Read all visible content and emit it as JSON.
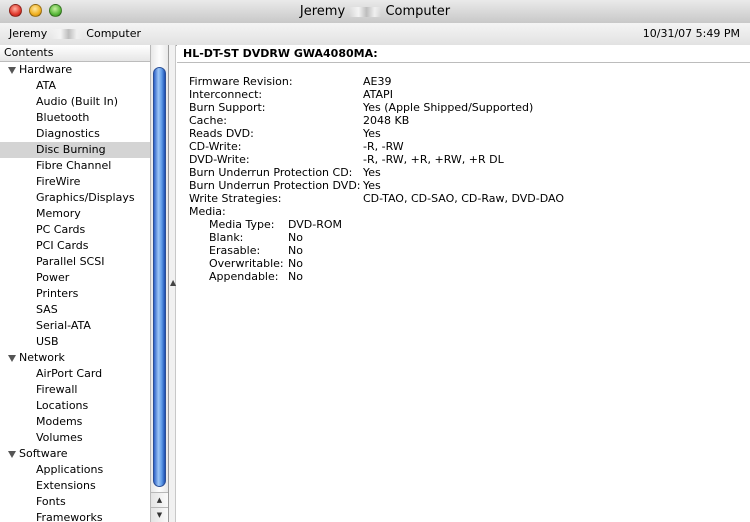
{
  "window": {
    "title_left": "Jeremy",
    "title_right": "Computer",
    "header_left_a": "Jeremy",
    "header_left_b": "Computer",
    "datetime": "10/31/07 5:49 PM"
  },
  "sidebar": {
    "header": "Contents",
    "rows": [
      {
        "label": "Hardware",
        "type": "category"
      },
      {
        "label": "ATA",
        "type": "item"
      },
      {
        "label": "Audio (Built In)",
        "type": "item"
      },
      {
        "label": "Bluetooth",
        "type": "item"
      },
      {
        "label": "Diagnostics",
        "type": "item"
      },
      {
        "label": "Disc Burning",
        "type": "item",
        "selected": true
      },
      {
        "label": "Fibre Channel",
        "type": "item"
      },
      {
        "label": "FireWire",
        "type": "item"
      },
      {
        "label": "Graphics/Displays",
        "type": "item"
      },
      {
        "label": "Memory",
        "type": "item"
      },
      {
        "label": "PC Cards",
        "type": "item"
      },
      {
        "label": "PCI Cards",
        "type": "item"
      },
      {
        "label": "Parallel SCSI",
        "type": "item"
      },
      {
        "label": "Power",
        "type": "item"
      },
      {
        "label": "Printers",
        "type": "item"
      },
      {
        "label": "SAS",
        "type": "item"
      },
      {
        "label": "Serial-ATA",
        "type": "item"
      },
      {
        "label": "USB",
        "type": "item"
      },
      {
        "label": "Network",
        "type": "category"
      },
      {
        "label": "AirPort Card",
        "type": "item"
      },
      {
        "label": "Firewall",
        "type": "item"
      },
      {
        "label": "Locations",
        "type": "item"
      },
      {
        "label": "Modems",
        "type": "item"
      },
      {
        "label": "Volumes",
        "type": "item"
      },
      {
        "label": "Software",
        "type": "category"
      },
      {
        "label": "Applications",
        "type": "item"
      },
      {
        "label": "Extensions",
        "type": "item"
      },
      {
        "label": "Fonts",
        "type": "item"
      },
      {
        "label": "Frameworks",
        "type": "item"
      }
    ]
  },
  "detail": {
    "device": "HL-DT-ST DVDRW GWA4080MA:",
    "properties": [
      {
        "label": "Firmware Revision:",
        "value": "AE39"
      },
      {
        "label": "Interconnect:",
        "value": "ATAPI"
      },
      {
        "label": "Burn Support:",
        "value": "Yes (Apple Shipped/Supported)"
      },
      {
        "label": "Cache:",
        "value": "2048 KB"
      },
      {
        "label": "Reads DVD:",
        "value": "Yes"
      },
      {
        "label": "CD-Write:",
        "value": "-R, -RW"
      },
      {
        "label": "DVD-Write:",
        "value": "-R, -RW, +R, +RW, +R DL"
      },
      {
        "label": "Burn Underrun Protection CD:",
        "value": "Yes"
      },
      {
        "label": "Burn Underrun Protection DVD:",
        "value": "Yes"
      },
      {
        "label": "Write Strategies:",
        "value": "CD-TAO, CD-SAO, CD-Raw, DVD-DAO"
      },
      {
        "label": "Media:",
        "value": ""
      }
    ],
    "media": [
      {
        "label": "Media Type:",
        "value": "DVD-ROM"
      },
      {
        "label": "Blank:",
        "value": "No"
      },
      {
        "label": "Erasable:",
        "value": "No"
      },
      {
        "label": "Overwritable:",
        "value": "No"
      },
      {
        "label": "Appendable:",
        "value": "No"
      }
    ]
  }
}
